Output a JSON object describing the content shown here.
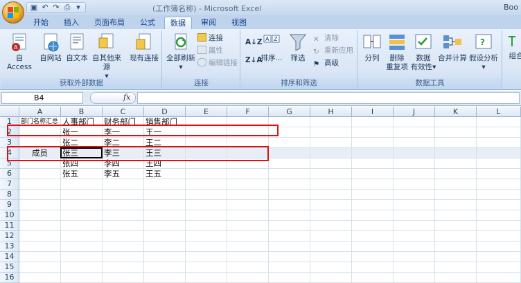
{
  "titlebar": {
    "title": "(工作簿名称) - Microsoft Excel",
    "right_text": "Boo"
  },
  "tabs": [
    "开始",
    "插入",
    "页面布局",
    "公式",
    "数据",
    "审阅",
    "视图"
  ],
  "active_tab": "数据",
  "ribbon": {
    "get_external": {
      "label": "获取外部数据",
      "buttons": [
        "自 Access",
        "自网站",
        "自文本",
        "自其他来源",
        "现有连接"
      ]
    },
    "connections": {
      "label": "连接",
      "refresh": "全部刷新",
      "items": [
        "连接",
        "属性",
        "编辑链接"
      ]
    },
    "sort_filter": {
      "label": "排序和筛选",
      "sort": "排序...",
      "filter": "筛选",
      "items": [
        "清除",
        "重新应用",
        "高级"
      ]
    },
    "data_tools": {
      "label": "数据工具",
      "split": "分列",
      "remove_dup": [
        "删除",
        "重复项"
      ],
      "validation": [
        "数据",
        "有效性"
      ],
      "consolidate": "合并计算",
      "whatif": "假设分析"
    },
    "outline": {
      "partial": "组合"
    }
  },
  "formula": {
    "name_box": "B4",
    "fx": "fx",
    "content": ""
  },
  "columns": [
    "A",
    "B",
    "C",
    "D",
    "E",
    "F",
    "G",
    "H",
    "I",
    "J",
    "K",
    "L"
  ],
  "rows": [
    "1",
    "2",
    "3",
    "4",
    "5",
    "6",
    "7",
    "8",
    "9",
    "10",
    "11",
    "12",
    "13",
    "14",
    "15",
    "16"
  ],
  "cells": {
    "A1": "部门名称汇总",
    "B1": "人事部门",
    "C1": "财务部门",
    "D1": "销售部门",
    "B2": "张一",
    "C2": "李一",
    "D2": "王一",
    "B3": "张二",
    "C3": "李二",
    "D3": "王二",
    "A4": "成员",
    "B4": "张三",
    "C4": "李三",
    "D4": "王三",
    "B5": "张四",
    "C5": "李四",
    "D5": "王四",
    "B6": "张五",
    "C6": "李五",
    "D6": "王五"
  },
  "colors": {
    "highlight": "#e01010",
    "ribbon_bg": "#dae6f5",
    "tab_text": "#15428b"
  }
}
